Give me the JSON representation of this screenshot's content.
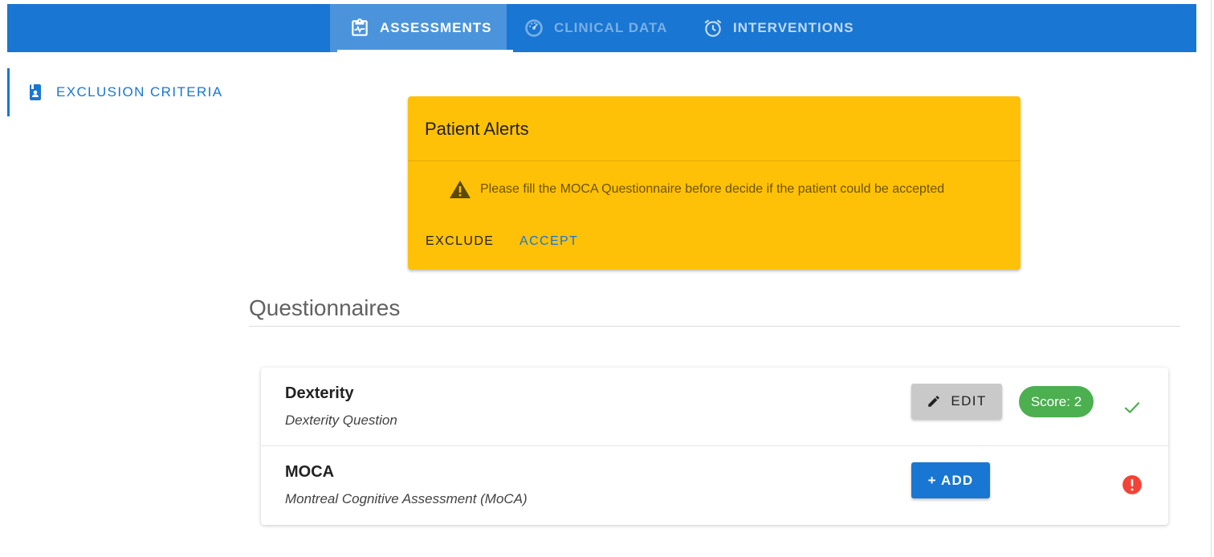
{
  "tabs": [
    {
      "label": "ASSESSMENTS",
      "icon": "clipboard-pulse-icon",
      "active": true
    },
    {
      "label": "CLINICAL DATA",
      "icon": "gauge-icon",
      "active": false
    },
    {
      "label": "INTERVENTIONS",
      "icon": "alarm-clock-icon",
      "active": false
    }
  ],
  "sidebar": {
    "items": [
      {
        "label": "EXCLUSION CRITERIA",
        "icon": "contact-book-icon",
        "active": true
      }
    ]
  },
  "alert": {
    "title": "Patient Alerts",
    "icon": "warning-icon",
    "message": "Please fill the MOCA Questionnaire before decide if the patient could be accepted",
    "exclude_label": "EXCLUDE",
    "accept_label": "ACCEPT"
  },
  "questionnaires": {
    "heading": "Questionnaires",
    "items": [
      {
        "name": "Dexterity",
        "description": "Dexterity Question",
        "action_label": "EDIT",
        "action_icon": "pencil-icon",
        "score": "Score: 2",
        "status_icon": "check-icon"
      },
      {
        "name": "MOCA",
        "description": "Montreal Cognitive Assessment (MoCA)",
        "action_label": "+ ADD",
        "status_icon": "error-icon"
      }
    ]
  },
  "colors": {
    "primary": "#1976d2",
    "alert_bg": "#ffc107",
    "success": "#4caf50",
    "error": "#f44336"
  }
}
